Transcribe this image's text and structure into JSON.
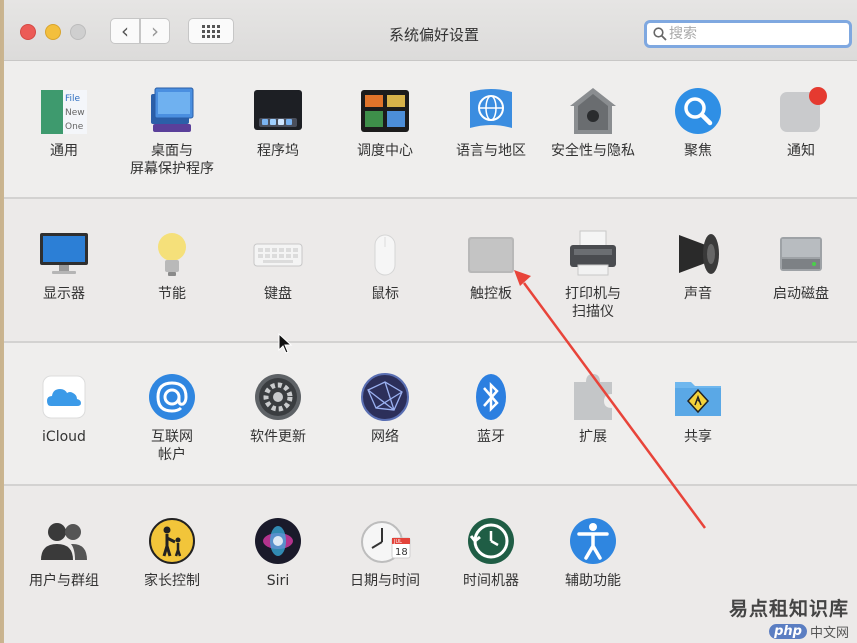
{
  "window": {
    "title": "系统偏好设置",
    "nav_back": "‹",
    "nav_forward": "›"
  },
  "search": {
    "placeholder": "搜索"
  },
  "panes": {
    "general": "通用",
    "desktop_l1": "桌面与",
    "desktop_l2": "屏幕保护程序",
    "dock": "程序坞",
    "mission": "调度中心",
    "language": "语言与地区",
    "security": "安全性与隐私",
    "spotlight": "聚焦",
    "notifications": "通知",
    "displays": "显示器",
    "energy": "节能",
    "keyboard": "键盘",
    "mouse": "鼠标",
    "trackpad": "触控板",
    "printers_l1": "打印机与",
    "printers_l2": "扫描仪",
    "sound": "声音",
    "startup": "启动磁盘",
    "icloud": "iCloud",
    "internet_l1": "互联网",
    "internet_l2": "帐户",
    "software": "软件更新",
    "network": "网络",
    "bluetooth": "蓝牙",
    "extensions": "扩展",
    "sharing": "共享",
    "users": "用户与群组",
    "parental": "家长控制",
    "siri": "Siri",
    "datetime": "日期与时间",
    "timemachine": "时间机器",
    "accessibility": "辅助功能"
  },
  "icon_text": {
    "general_l1": "File",
    "general_l2": "New",
    "general_l3": "One",
    "calendar_month": "JUL",
    "calendar_day": "18"
  },
  "watermark": {
    "site": "易点租知识库",
    "logo_php": "php",
    "logo_cn": "中文网"
  },
  "colors": {
    "arrow": "#e8443a",
    "search_focus": "#7fa8e0"
  }
}
